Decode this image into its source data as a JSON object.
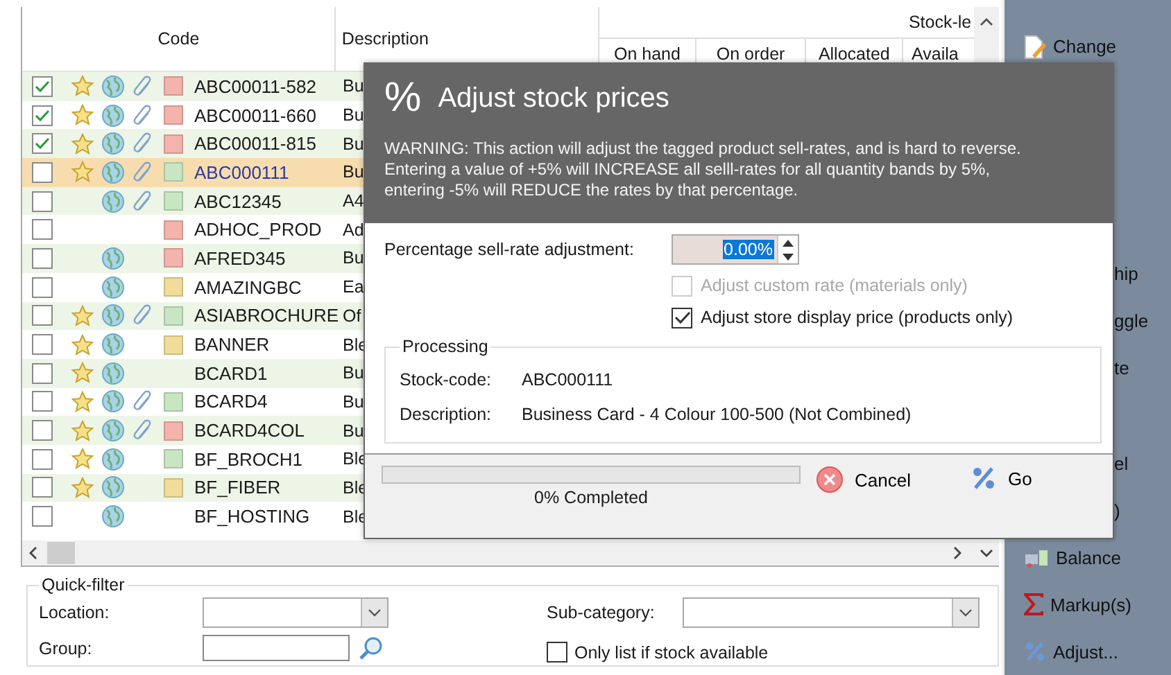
{
  "table": {
    "columns": [
      "Code",
      "Description"
    ],
    "stock_group": "Stock-le",
    "stock_columns": [
      "On hand",
      "On order",
      "Allocated",
      "Availa"
    ],
    "rows": [
      {
        "checked": true,
        "starred": true,
        "web": true,
        "attachment": true,
        "color": "#f4b3ab",
        "code": "ABC00011-582",
        "description": "Bu",
        "selected": false
      },
      {
        "checked": true,
        "starred": true,
        "web": true,
        "attachment": true,
        "color": "#f4b3ab",
        "code": "ABC00011-660",
        "description": "Bu",
        "selected": false
      },
      {
        "checked": true,
        "starred": true,
        "web": true,
        "attachment": true,
        "color": "#f4b3ab",
        "code": "ABC00011-815",
        "description": "Bu",
        "selected": false
      },
      {
        "checked": false,
        "starred": true,
        "web": true,
        "attachment": true,
        "color": "#c8e6c2",
        "code": "ABC000111",
        "description": "Bu",
        "selected": true
      },
      {
        "checked": false,
        "starred": false,
        "web": true,
        "attachment": true,
        "color": "#c8e6c2",
        "code": "ABC12345",
        "description": "A4",
        "selected": false
      },
      {
        "checked": false,
        "starred": false,
        "web": false,
        "attachment": false,
        "color": "#f4b3ab",
        "code": "ADHOC_PROD",
        "description": "Ad",
        "selected": false
      },
      {
        "checked": false,
        "starred": false,
        "web": true,
        "attachment": false,
        "color": "#f4b3ab",
        "code": "AFRED345",
        "description": "Bu",
        "selected": false
      },
      {
        "checked": false,
        "starred": false,
        "web": true,
        "attachment": false,
        "color": "#f2dc9a",
        "code": "AMAZINGBC",
        "description": "Ea",
        "selected": false
      },
      {
        "checked": false,
        "starred": true,
        "web": true,
        "attachment": true,
        "color": "#c8e6c2",
        "code": "ASIABROCHURE",
        "description": "Of",
        "selected": false
      },
      {
        "checked": false,
        "starred": true,
        "web": true,
        "attachment": false,
        "color": "#f2dc9a",
        "code": "BANNER",
        "description": "Ble",
        "selected": false
      },
      {
        "checked": false,
        "starred": true,
        "web": true,
        "attachment": false,
        "code": "BCARD1",
        "description": "Bu",
        "selected": false
      },
      {
        "checked": false,
        "starred": true,
        "web": true,
        "attachment": true,
        "color": "#c8e6c2",
        "code": "BCARD4",
        "description": "Bu",
        "selected": false
      },
      {
        "checked": false,
        "starred": true,
        "web": true,
        "attachment": true,
        "color": "#f4b3ab",
        "code": "BCARD4COL",
        "description": "Bu",
        "selected": false
      },
      {
        "checked": false,
        "starred": true,
        "web": true,
        "attachment": false,
        "color": "#c8e6c2",
        "code": "BF_BROCH1",
        "description": "Ble",
        "selected": false
      },
      {
        "checked": false,
        "starred": true,
        "web": true,
        "attachment": false,
        "color": "#f2dc9a",
        "code": "BF_FIBER",
        "description": "Ble",
        "selected": false
      },
      {
        "checked": false,
        "starred": false,
        "web": true,
        "attachment": false,
        "code": "BF_HOSTING",
        "description": "Ble",
        "selected": false
      }
    ]
  },
  "quick_filter": {
    "title": "Quick-filter",
    "location": {
      "label": "Location:"
    },
    "group": {
      "label": "Group:"
    },
    "sub_category": {
      "label": "Sub-category:"
    },
    "stock_only": {
      "label": "Only list if stock available",
      "checked": false
    }
  },
  "sidebar": {
    "items": [
      {
        "kind": "document",
        "label": "Change"
      },
      {
        "kind": "covered",
        "label": "hip"
      },
      {
        "kind": "covered",
        "label": "ggle"
      },
      {
        "kind": "covered",
        "label": "te"
      },
      {
        "kind": "covered",
        "label": "el"
      },
      {
        "kind": "covered",
        "label": ")"
      },
      {
        "kind": "balance",
        "label": "Balance"
      },
      {
        "kind": "sum",
        "label": "Markup(s)"
      },
      {
        "kind": "percent",
        "label": "Adjust..."
      }
    ]
  },
  "dialog": {
    "icon": "%",
    "title": "Adjust stock prices",
    "warning": "WARNING: This action will adjust the tagged product sell-rates, and is hard to reverse. Entering a value of +5% will INCREASE all selll-rates for all quantity bands by 5%, entering -5% will REDUCE the rates by that percentage.",
    "adjustment": {
      "label": "Percentage sell-rate adjustment:",
      "value": "0.00%"
    },
    "options": [
      {
        "label": "Adjust custom rate (materials only)",
        "checked": false,
        "disabled": true
      },
      {
        "label": "Adjust store display price (products only)",
        "checked": true,
        "disabled": false
      }
    ],
    "processing": {
      "title": "Processing",
      "fields": [
        {
          "label": "Stock-code:",
          "value": "ABC000111"
        },
        {
          "label": "Description:",
          "value": "Business Card - 4 Colour 100-500 (Not Combined)"
        }
      ]
    },
    "progress": {
      "level": 0,
      "text": "0% Completed"
    },
    "buttons": [
      {
        "kind": "cancel",
        "label": "Cancel"
      },
      {
        "kind": "go",
        "label": "Go"
      }
    ]
  }
}
